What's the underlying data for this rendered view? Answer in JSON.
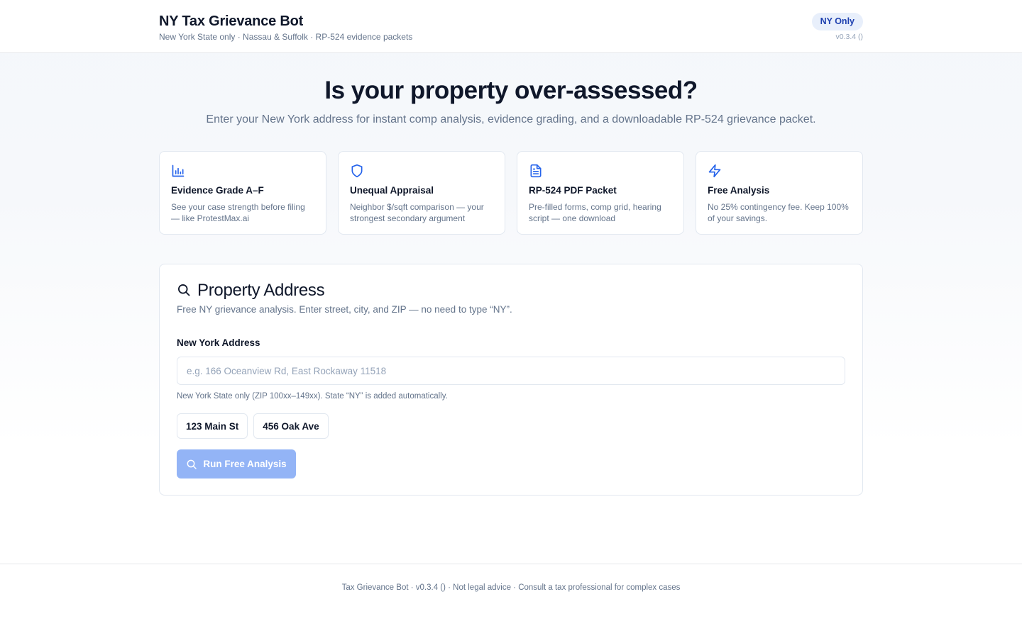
{
  "header": {
    "title": "NY Tax Grievance Bot",
    "subtitle": "New York State only · Nassau & Suffolk · RP-524 evidence packets",
    "badge": "NY Only",
    "version": "v0.3.4 ()"
  },
  "hero": {
    "title": "Is your property over-assessed?",
    "subtitle": "Enter your New York address for instant comp analysis, evidence grading, and a downloadable RP-524 grievance packet."
  },
  "features": [
    {
      "icon": "bar-chart-icon",
      "title": "Evidence Grade A–F",
      "desc": "See your case strength before filing — like ProtestMax.ai"
    },
    {
      "icon": "shield-icon",
      "title": "Unequal Appraisal",
      "desc": "Neighbor $/sqft comparison — your strongest secondary argument"
    },
    {
      "icon": "document-icon",
      "title": "RP-524 PDF Packet",
      "desc": "Pre-filled forms, comp grid, hearing script — one download"
    },
    {
      "icon": "lightning-icon",
      "title": "Free Analysis",
      "desc": "No 25% contingency fee. Keep 100% of your savings."
    }
  ],
  "address_form": {
    "icon": "search-icon",
    "title": "Property Address",
    "subtitle": "Free NY grievance analysis. Enter street, city, and ZIP — no need to type “NY”.",
    "field_label": "New York Address",
    "input_value": "",
    "input_placeholder": "e.g. 166 Oceanview Rd, East Rockaway 11518",
    "hint": "New York State only (ZIP 100xx–149xx). State “NY” is added automatically.",
    "suggestions": [
      "123 Main St",
      "456 Oak Ave"
    ],
    "submit_label": "Run Free Analysis"
  },
  "footer": {
    "text": "Tax Grievance Bot · v0.3.4 () · Not legal advice · Consult a tax professional for complex cases"
  },
  "colors": {
    "primary_text": "#0f172a",
    "muted_text": "#64748b",
    "accent_blue": "#2563eb",
    "badge_bg": "#e8effb",
    "button_disabled_bg": "#93b4f6",
    "border": "#e2e8f0"
  }
}
